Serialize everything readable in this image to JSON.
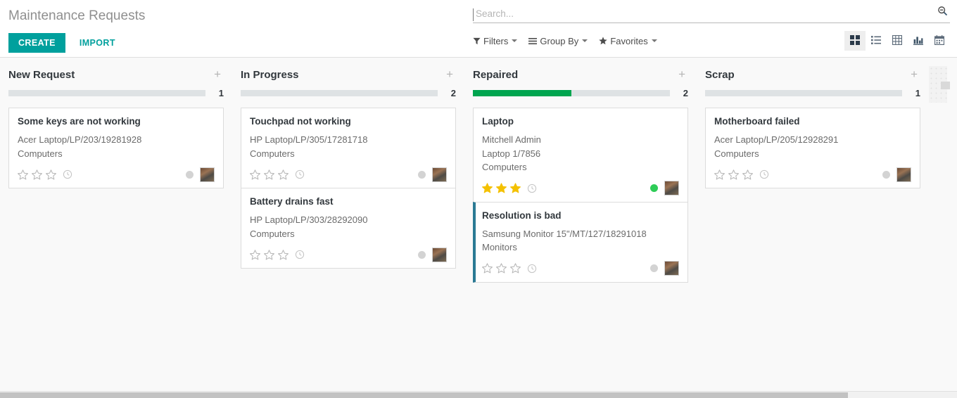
{
  "header": {
    "title": "Maintenance Requests",
    "create_label": "CREATE",
    "import_label": "IMPORT"
  },
  "search": {
    "placeholder": "Search...",
    "value": "",
    "icon": "search-minus-icon"
  },
  "filters": [
    {
      "label": "Filters",
      "icon": "funnel-icon"
    },
    {
      "label": "Group By",
      "icon": "bars-icon"
    },
    {
      "label": "Favorites",
      "icon": "star-icon"
    }
  ],
  "views": [
    {
      "name": "kanban",
      "icon": "kanban-icon",
      "active": true
    },
    {
      "name": "list",
      "icon": "list-icon",
      "active": false
    },
    {
      "name": "pivot",
      "icon": "pivot-table-icon",
      "active": false
    },
    {
      "name": "graph",
      "icon": "bar-chart-icon",
      "active": false
    },
    {
      "name": "calendar",
      "icon": "calendar-icon",
      "active": false
    }
  ],
  "columns": [
    {
      "title": "New Request",
      "count": "1",
      "add_icon": "plus-icon",
      "progress_percent": 0,
      "cards": [
        {
          "title": "Some keys are not working",
          "lines": [
            "Acer Laptop/LP/203/19281928",
            "Computers"
          ],
          "stars": 0,
          "clock_icon": "clock-icon",
          "status": "grey",
          "accent": false
        }
      ]
    },
    {
      "title": "In Progress",
      "count": "2",
      "add_icon": "plus-icon",
      "progress_percent": 0,
      "cards": [
        {
          "title": "Touchpad not working",
          "lines": [
            "HP Laptop/LP/305/17281718",
            "Computers"
          ],
          "stars": 0,
          "clock_icon": "clock-icon",
          "status": "grey",
          "accent": false
        },
        {
          "title": "Battery drains fast",
          "lines": [
            "HP Laptop/LP/303/28292090",
            "Computers"
          ],
          "stars": 0,
          "clock_icon": "clock-icon",
          "status": "grey",
          "accent": false
        }
      ]
    },
    {
      "title": "Repaired",
      "count": "2",
      "add_icon": "plus-icon",
      "progress_percent": 50,
      "cards": [
        {
          "title": "Laptop",
          "lines": [
            "Mitchell Admin",
            "Laptop 1/7856",
            "Computers"
          ],
          "stars": 3,
          "clock_icon": "clock-icon",
          "status": "green",
          "accent": false
        },
        {
          "title": "Resolution is bad",
          "lines": [
            "Samsung Monitor 15\"/MT/127/18291018",
            "Monitors"
          ],
          "stars": 0,
          "clock_icon": "clock-icon",
          "status": "grey",
          "accent": true
        }
      ]
    },
    {
      "title": "Scrap",
      "count": "1",
      "add_icon": "plus-icon",
      "progress_percent": 0,
      "cards": [
        {
          "title": "Motherboard failed",
          "lines": [
            "Acer Laptop/LP/205/12928291",
            "Computers"
          ],
          "stars": 0,
          "clock_icon": "clock-icon",
          "status": "grey",
          "accent": false
        }
      ]
    }
  ],
  "colors": {
    "brand_teal": "#00a09d",
    "progress_green": "#00a54f",
    "star_gold": "#f4c100",
    "status_green": "#2ecc57",
    "card_accent": "#2b7a94"
  }
}
